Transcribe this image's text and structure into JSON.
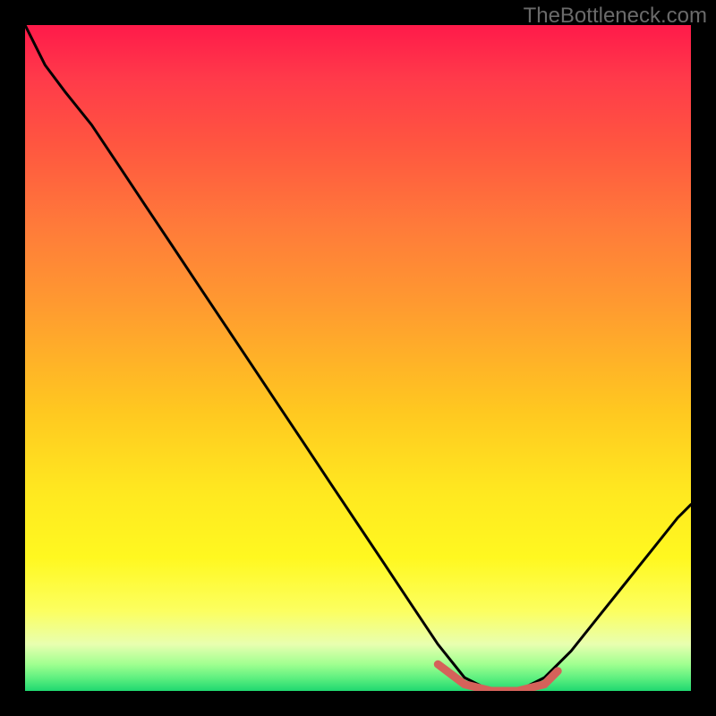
{
  "watermark": "TheBottleneck.com",
  "chart_data": {
    "type": "line",
    "title": "",
    "xlabel": "",
    "ylabel": "",
    "xlim": [
      0,
      100
    ],
    "ylim": [
      0,
      100
    ],
    "grid": false,
    "legend": false,
    "note": "V-shaped bottleneck curve over heatmap gradient; minimum near x≈68–78, y≈100 (bottom edge). Values are relative percentages estimated from pixel positions.",
    "series": [
      {
        "name": "bottleneck-curve",
        "color": "#000000",
        "x": [
          0,
          3,
          6,
          10,
          14,
          18,
          22,
          26,
          30,
          34,
          38,
          42,
          46,
          50,
          54,
          58,
          62,
          66,
          70,
          74,
          78,
          82,
          86,
          90,
          94,
          98,
          100
        ],
        "y": [
          0,
          6,
          10,
          15,
          21,
          27,
          33,
          39,
          45,
          51,
          57,
          63,
          69,
          75,
          81,
          87,
          93,
          98,
          100,
          100,
          98,
          94,
          89,
          84,
          79,
          74,
          72
        ]
      }
    ],
    "accent_segment": {
      "name": "optimal-range-highlight",
      "color": "#d5625a",
      "x": [
        62,
        66,
        70,
        74,
        78,
        80
      ],
      "y": [
        96,
        99,
        100,
        100,
        99,
        97
      ]
    },
    "background_gradient": {
      "orientation": "vertical",
      "stops": [
        {
          "pos": 0.0,
          "color": "#ff1a4a"
        },
        {
          "pos": 0.18,
          "color": "#ff5640"
        },
        {
          "pos": 0.42,
          "color": "#ff9a30"
        },
        {
          "pos": 0.7,
          "color": "#ffe820"
        },
        {
          "pos": 0.88,
          "color": "#fcff60"
        },
        {
          "pos": 0.96,
          "color": "#a0ff90"
        },
        {
          "pos": 1.0,
          "color": "#20d870"
        }
      ]
    }
  }
}
